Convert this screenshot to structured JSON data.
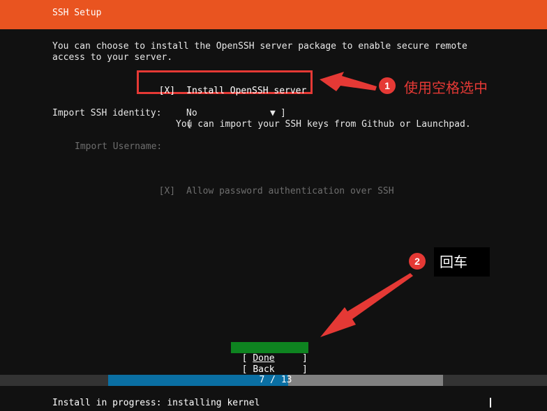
{
  "header": {
    "title": "SSH Setup"
  },
  "intro": {
    "line1": "You can choose to install the OpenSSH server package to enable secure remote",
    "line2": "access to your server."
  },
  "install_checkbox": {
    "mark": "[X]",
    "label": "Install OpenSSH server",
    "checked": true
  },
  "ssh_identity": {
    "label": "Import SSH identity:",
    "select_open": "[",
    "value": "No",
    "select_arrow": "▼",
    "select_close": "]",
    "help": "You can import your SSH keys from Github or Launchpad."
  },
  "import_username": {
    "label": "Import Username:",
    "value": ""
  },
  "password_auth": {
    "mark": "[X]",
    "label": "Allow password authentication over SSH",
    "checked": true
  },
  "buttons": {
    "done_open": "[ ",
    "done_label": "Done",
    "done_close": "]",
    "back_open": "[ ",
    "back_label": "Back",
    "back_close": "]"
  },
  "progress": {
    "current": 7,
    "total": 13,
    "text": "7 / 13"
  },
  "status": {
    "text": "Install in progress: installing kernel"
  },
  "annotations": {
    "badge1": "1",
    "note1": "使用空格选中",
    "badge2": "2",
    "note2": "回车",
    "accent_color": "#e53935"
  },
  "colors": {
    "header": "#e95420",
    "background": "#111111",
    "done_button": "#0e8420",
    "progress_fill": "#0a6fa3",
    "progress_track": "#808080"
  }
}
